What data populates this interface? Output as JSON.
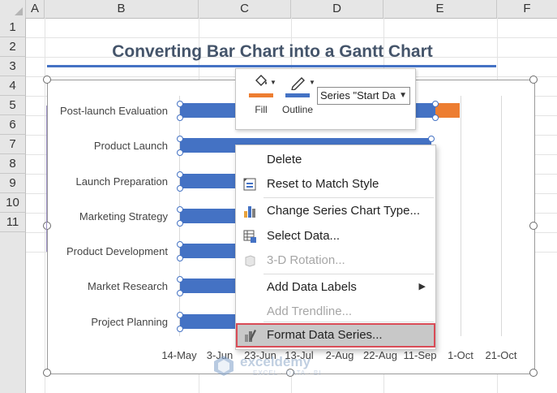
{
  "sheet": {
    "columns": [
      "A",
      "B",
      "C",
      "D",
      "E",
      "F"
    ],
    "rows": [
      "1",
      "2",
      "3",
      "4",
      "5",
      "6",
      "7",
      "8",
      "9",
      "10",
      "11"
    ]
  },
  "title": "Converting Bar Chart into a Gantt Chart",
  "chart_data": {
    "type": "bar",
    "categories": [
      "Post-launch Evaluation",
      "Product Launch",
      "Launch Preparation",
      "Marketing Strategy",
      "Product Development",
      "Market Research",
      "Project Planning"
    ],
    "x_ticks": [
      "14-May",
      "3-Jun",
      "23-Jun",
      "13-Jul",
      "2-Aug",
      "22-Aug",
      "11-Sep",
      "1-Oct",
      "21-Oct"
    ],
    "series": [
      {
        "values_start": [
          "14-May",
          "14-May",
          "14-May",
          "14-May",
          "14-May",
          "14-May",
          "14-May"
        ]
      },
      {
        "values_end_visible": [
          "19-Sep",
          "7-Sep",
          "",
          "",
          "",
          "",
          ""
        ]
      }
    ],
    "colors": {
      "start_series": "#4472c4",
      "duration_series": "#ed7d31"
    },
    "gridlines": true
  },
  "mini_toolbar": {
    "fill_label": "Fill",
    "outline_label": "Outline",
    "series_select": "Series \"Start Da"
  },
  "context_menu": {
    "items": [
      {
        "label": "Delete",
        "icon": "delete-icon",
        "disabled": false
      },
      {
        "label": "Reset to Match Style",
        "icon": "reset-style-icon",
        "disabled": false
      },
      {
        "label": "Change Series Chart Type...",
        "icon": "chart-type-icon",
        "disabled": false
      },
      {
        "label": "Select Data...",
        "icon": "select-data-icon",
        "disabled": false
      },
      {
        "label": "3-D Rotation...",
        "icon": "3d-rotation-icon",
        "disabled": true
      },
      {
        "label": "Add Data Labels",
        "icon": "",
        "disabled": false,
        "submenu": true
      },
      {
        "label": "Add Trendline...",
        "icon": "",
        "disabled": true
      },
      {
        "label": "Format Data Series...",
        "icon": "format-series-icon",
        "disabled": false,
        "highlighted": true
      }
    ]
  },
  "watermark": {
    "name": "exceldemy",
    "tagline": "EXCEL · DATA · BI"
  }
}
